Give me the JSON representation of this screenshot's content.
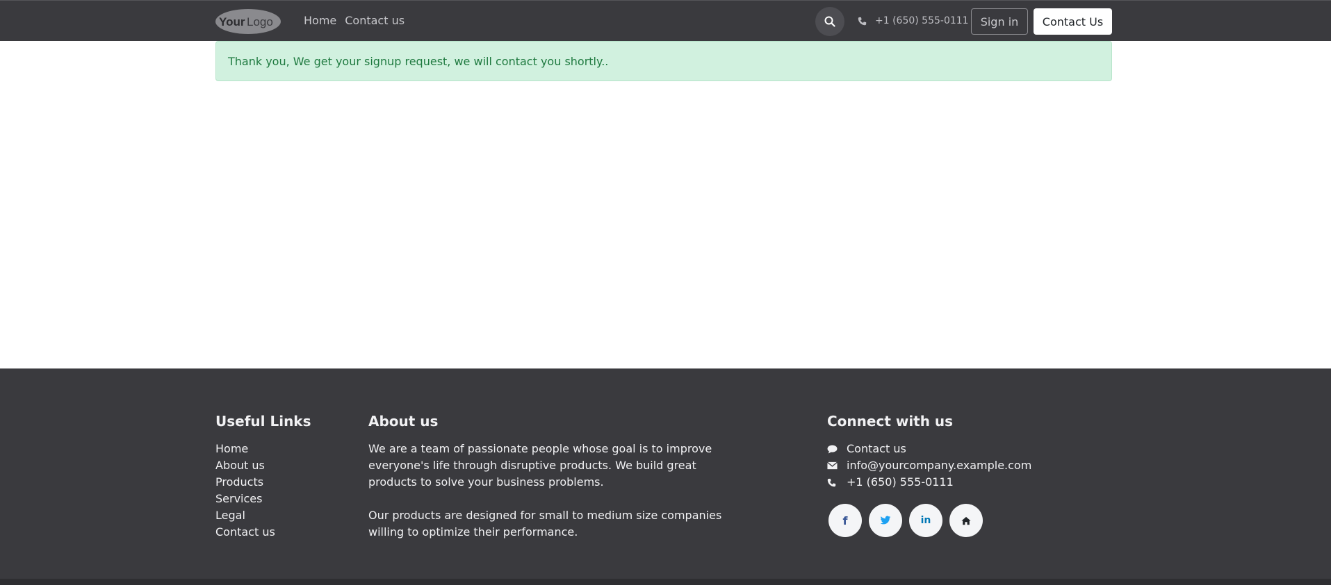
{
  "header": {
    "logo_text_dark": "Your",
    "logo_text_light": "Logo",
    "nav": [
      "Home",
      "Contact us"
    ],
    "phone": "+1 (650) 555-0111",
    "signin_label": "Sign in",
    "contact_label": "Contact Us"
  },
  "alert": {
    "message": "Thank you, We get your signup request, we will contact you shortly.."
  },
  "footer": {
    "useful_links": {
      "heading": "Useful Links",
      "items": [
        "Home",
        "About us",
        "Products",
        "Services",
        "Legal",
        "Contact us"
      ]
    },
    "about": {
      "heading": "About us",
      "paragraphs": [
        "We are a team of passionate people whose goal is to improve everyone's life through disruptive products. We build great products to solve your business problems.",
        "Our products are designed for small to medium size companies willing to optimize their performance."
      ]
    },
    "connect": {
      "heading": "Connect with us",
      "items": [
        {
          "icon": "comment-icon",
          "label": "Contact us"
        },
        {
          "icon": "envelope-icon",
          "label": "info@yourcompany.example.com"
        },
        {
          "icon": "phone-icon",
          "label": "+1 (650) 555-0111"
        }
      ],
      "socials": [
        {
          "icon": "facebook-icon",
          "glyph": "f",
          "color": "#3b5998"
        },
        {
          "icon": "twitter-icon",
          "glyph": "🐦",
          "color": "#1da1f2"
        },
        {
          "icon": "linkedin-icon",
          "glyph": "in",
          "color": "#0077b5"
        },
        {
          "icon": "home-icon",
          "glyph": "⌂",
          "color": "#212529"
        }
      ]
    }
  },
  "colors": {
    "header_bg": "#3a3a3e",
    "alert_bg": "#d1f1df",
    "alert_text": "#1f7a40",
    "footer_bg": "#3a3a3e"
  }
}
